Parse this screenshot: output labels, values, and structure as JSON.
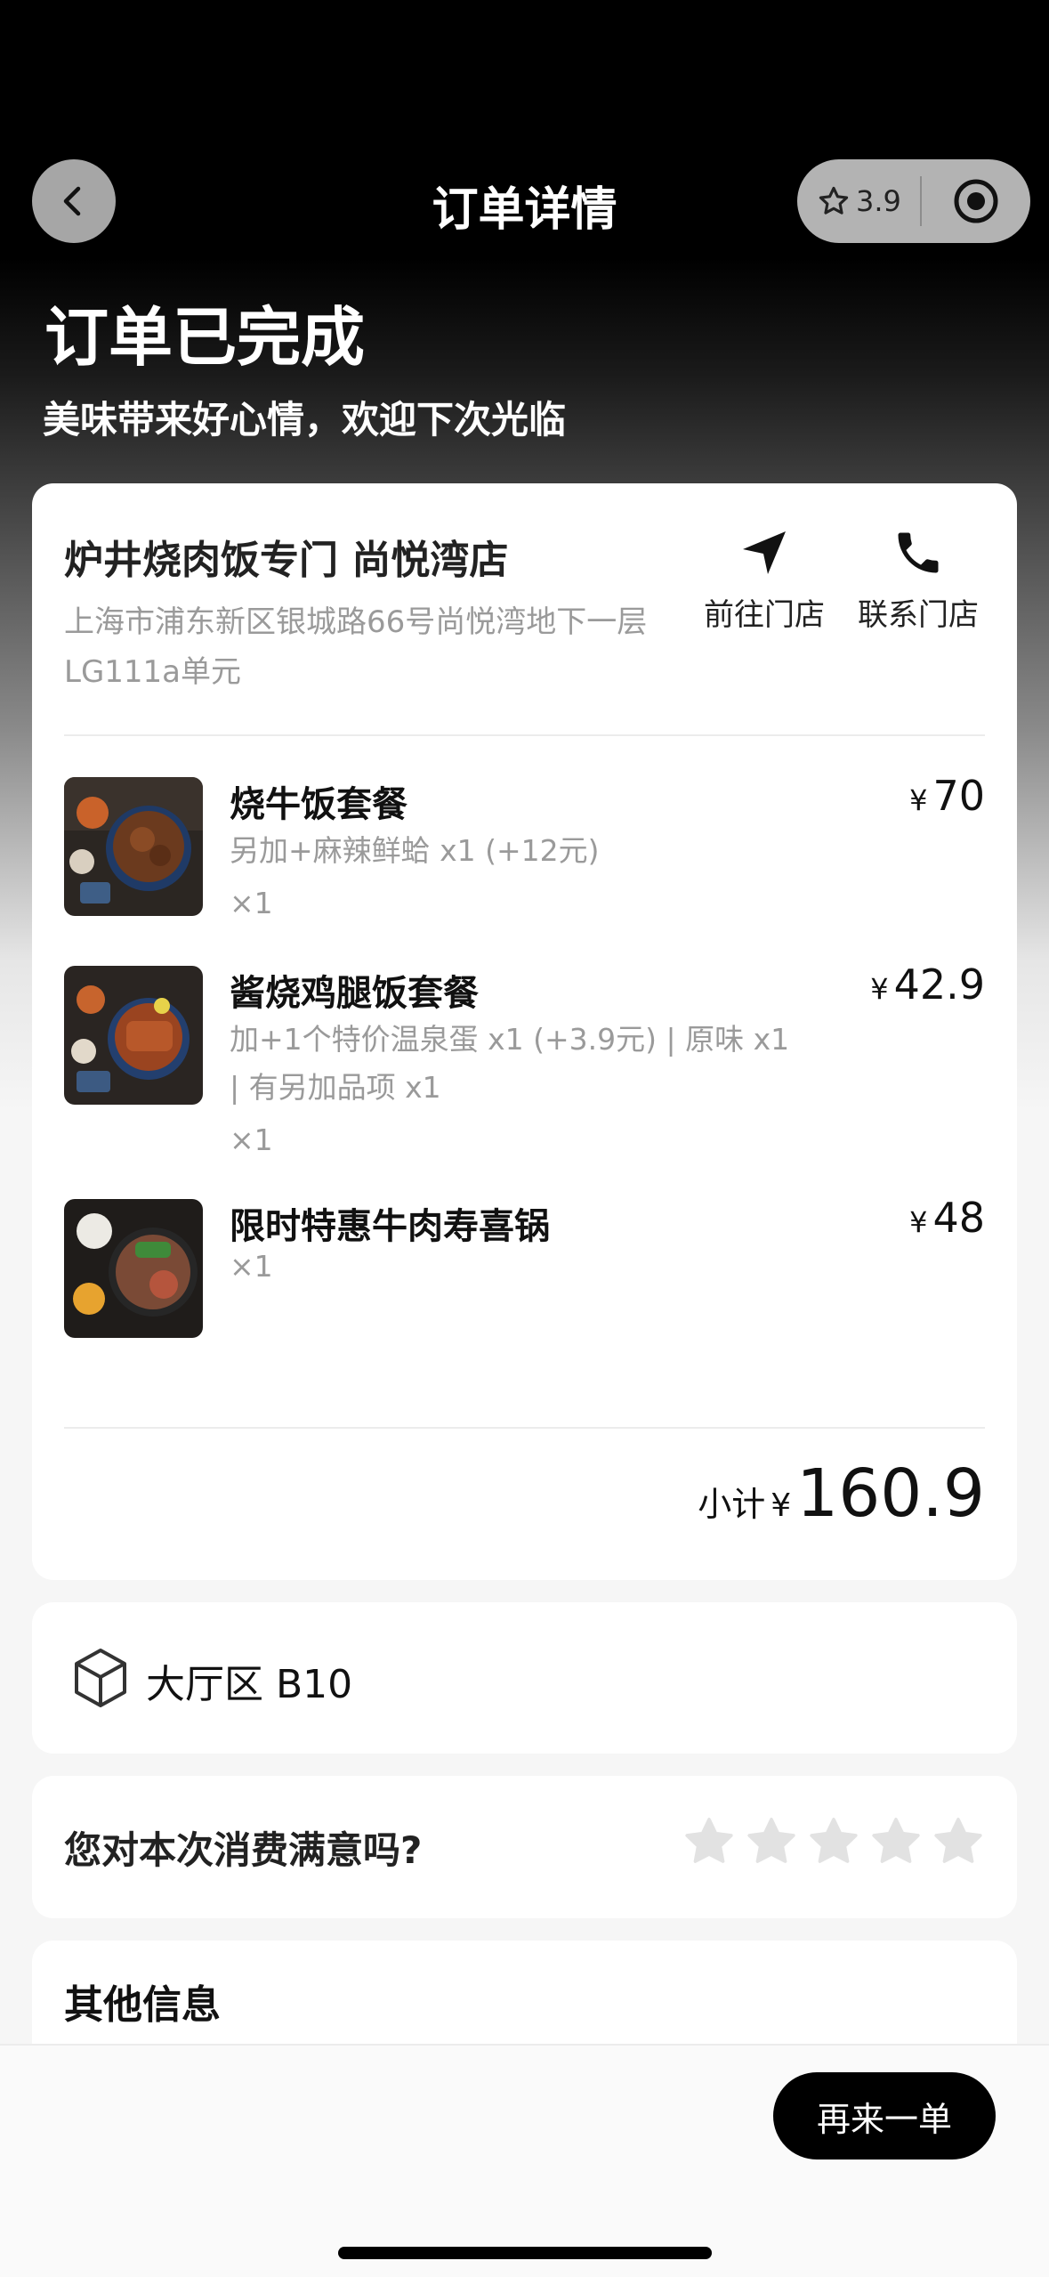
{
  "nav": {
    "title": "订单详情",
    "rating": "3.9"
  },
  "status": {
    "title": "订单已完成",
    "subtitle": "美味带来好心情，欢迎下次光临"
  },
  "store": {
    "name": "炉井烧肉饭专门 尚悦湾店",
    "address": "上海市浦东新区银城路66号尚悦湾地下一层LG111a单元",
    "go_label": "前往门店",
    "contact_label": "联系门店"
  },
  "items": [
    {
      "name": "烧牛饭套餐",
      "options": "另加+麻辣鲜蛤 x1 (+12元)",
      "qty": "×1",
      "price": "70",
      "currency": "¥"
    },
    {
      "name": "酱烧鸡腿饭套餐",
      "options": "加+1个特价温泉蛋 x1 (+3.9元) | 原味 x1 | 有另加品项 x1",
      "qty": "×1",
      "price": "42.9",
      "currency": "¥"
    },
    {
      "name": "限时特惠牛肉寿喜锅",
      "options": "",
      "qty": "×1",
      "price": "48",
      "currency": "¥"
    }
  ],
  "subtotal": {
    "label": "小计",
    "currency": "¥",
    "value": "160.9"
  },
  "table": {
    "text": "大厅区 B10"
  },
  "rating": {
    "question": "您对本次消费满意吗?",
    "stars": 5,
    "selected": 0
  },
  "other": {
    "title": "其他信息"
  },
  "footer": {
    "reorder_label": "再来一单"
  },
  "colors": {
    "accent": "#000000",
    "star_empty": "#e2e2e2",
    "muted_text": "#9a9a9a"
  }
}
